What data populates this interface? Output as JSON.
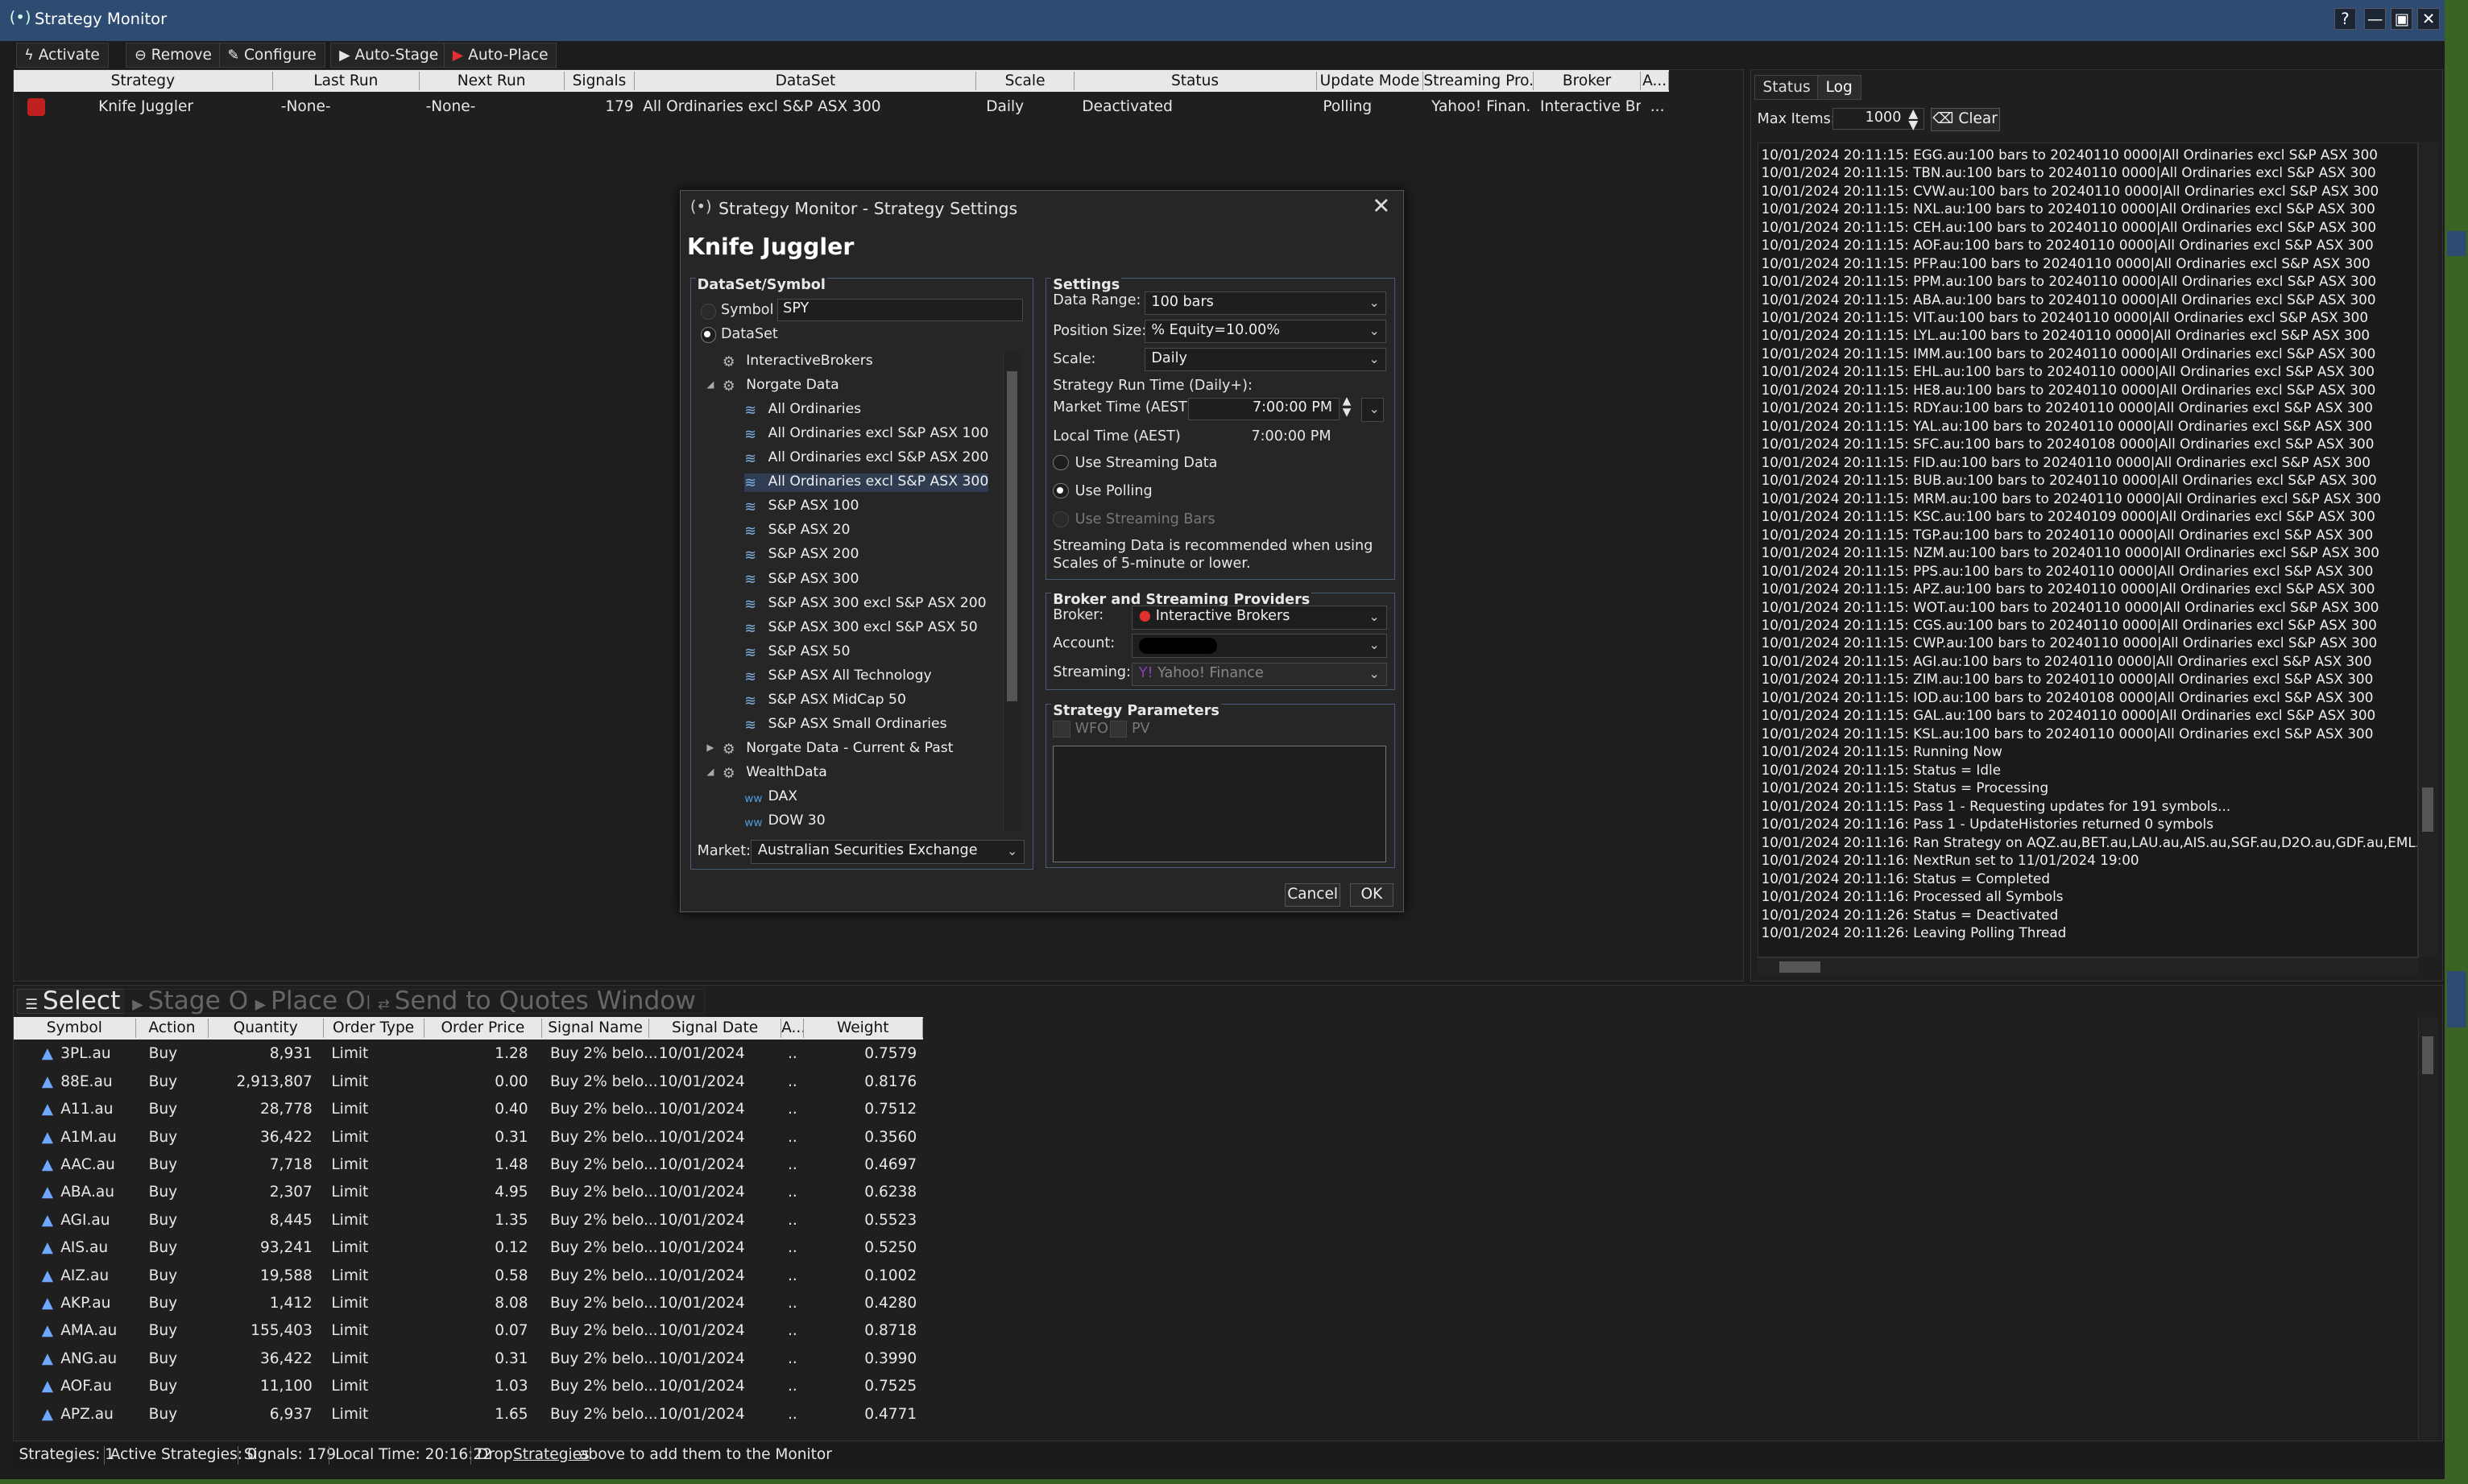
{
  "window": {
    "title": "Strategy Monitor",
    "help": "?",
    "minimize": "—",
    "maximize": "▣",
    "close": "✕"
  },
  "toolbar": {
    "activate": "Activate",
    "remove": "Remove",
    "configure": "Configure",
    "auto_stage": "Auto-Stage",
    "auto_place": "Auto-Place"
  },
  "strategies": {
    "columns": [
      "Strategy",
      "Last Run",
      "Next Run",
      "Signals",
      "DataSet",
      "Scale",
      "Status",
      "Update Mode",
      "Streaming Pro...",
      "Broker",
      "A..."
    ],
    "row": {
      "strategy": "Knife Juggler",
      "last_run": "-None-",
      "next_run": "-None-",
      "signals": "179",
      "dataset": "All Ordinaries excl S&P ASX 300",
      "scale": "Daily",
      "status": "Deactivated",
      "update_mode": "Polling",
      "streaming": "Yahoo! Finan...",
      "broker": "Interactive Br...",
      "a": "..."
    }
  },
  "right": {
    "tab_status": "Status",
    "tab_log": "Log",
    "max_items_label": "Max Items:",
    "max_items": "1000",
    "clear": "Clear",
    "log": [
      "10/01/2024 20:11:15: EGG.au:100 bars to 20240110 0000|All Ordinaries excl S&P ASX 300",
      "10/01/2024 20:11:15: TBN.au:100 bars to 20240110 0000|All Ordinaries excl S&P ASX 300",
      "10/01/2024 20:11:15: CVW.au:100 bars to 20240110 0000|All Ordinaries excl S&P ASX 300",
      "10/01/2024 20:11:15: NXL.au:100 bars to 20240110 0000|All Ordinaries excl S&P ASX 300",
      "10/01/2024 20:11:15: CEH.au:100 bars to 20240110 0000|All Ordinaries excl S&P ASX 300",
      "10/01/2024 20:11:15: AOF.au:100 bars to 20240110 0000|All Ordinaries excl S&P ASX 300",
      "10/01/2024 20:11:15: PFP.au:100 bars to 20240110 0000|All Ordinaries excl S&P ASX 300",
      "10/01/2024 20:11:15: PPM.au:100 bars to 20240110 0000|All Ordinaries excl S&P ASX 300",
      "10/01/2024 20:11:15: ABA.au:100 bars to 20240110 0000|All Ordinaries excl S&P ASX 300",
      "10/01/2024 20:11:15: VIT.au:100 bars to 20240110 0000|All Ordinaries excl S&P ASX 300",
      "10/01/2024 20:11:15: LYL.au:100 bars to 20240110 0000|All Ordinaries excl S&P ASX 300",
      "10/01/2024 20:11:15: IMM.au:100 bars to 20240110 0000|All Ordinaries excl S&P ASX 300",
      "10/01/2024 20:11:15: EHL.au:100 bars to 20240110 0000|All Ordinaries excl S&P ASX 300",
      "10/01/2024 20:11:15: HE8.au:100 bars to 20240110 0000|All Ordinaries excl S&P ASX 300",
      "10/01/2024 20:11:15: RDY.au:100 bars to 20240110 0000|All Ordinaries excl S&P ASX 300",
      "10/01/2024 20:11:15: YAL.au:100 bars to 20240110 0000|All Ordinaries excl S&P ASX 300",
      "10/01/2024 20:11:15: SFC.au:100 bars to 20240108 0000|All Ordinaries excl S&P ASX 300",
      "10/01/2024 20:11:15: FID.au:100 bars to 20240110 0000|All Ordinaries excl S&P ASX 300",
      "10/01/2024 20:11:15: BUB.au:100 bars to 20240110 0000|All Ordinaries excl S&P ASX 300",
      "10/01/2024 20:11:15: MRM.au:100 bars to 20240110 0000|All Ordinaries excl S&P ASX 300",
      "10/01/2024 20:11:15: KSC.au:100 bars to 20240109 0000|All Ordinaries excl S&P ASX 300",
      "10/01/2024 20:11:15: TGP.au:100 bars to 20240110 0000|All Ordinaries excl S&P ASX 300",
      "10/01/2024 20:11:15: NZM.au:100 bars to 20240110 0000|All Ordinaries excl S&P ASX 300",
      "10/01/2024 20:11:15: PPS.au:100 bars to 20240110 0000|All Ordinaries excl S&P ASX 300",
      "10/01/2024 20:11:15: APZ.au:100 bars to 20240110 0000|All Ordinaries excl S&P ASX 300",
      "10/01/2024 20:11:15: WOT.au:100 bars to 20240110 0000|All Ordinaries excl S&P ASX 300",
      "10/01/2024 20:11:15: CGS.au:100 bars to 20240110 0000|All Ordinaries excl S&P ASX 300",
      "10/01/2024 20:11:15: CWP.au:100 bars to 20240110 0000|All Ordinaries excl S&P ASX 300",
      "10/01/2024 20:11:15: AGI.au:100 bars to 20240110 0000|All Ordinaries excl S&P ASX 300",
      "10/01/2024 20:11:15: ZIM.au:100 bars to 20240110 0000|All Ordinaries excl S&P ASX 300",
      "10/01/2024 20:11:15: IOD.au:100 bars to 20240108 0000|All Ordinaries excl S&P ASX 300",
      "10/01/2024 20:11:15: GAL.au:100 bars to 20240110 0000|All Ordinaries excl S&P ASX 300",
      "10/01/2024 20:11:15: KSL.au:100 bars to 20240110 0000|All Ordinaries excl S&P ASX 300",
      "10/01/2024 20:11:15: Running Now",
      "10/01/2024 20:11:15: Status = Idle",
      "10/01/2024 20:11:15: Status = Processing",
      "10/01/2024 20:11:15: Pass 1 - Requesting updates for 191 symbols...",
      "10/01/2024 20:11:16: Pass 1 - UpdateHistories returned 0 symbols",
      "10/01/2024 20:11:16: Ran Strategy on AQZ.au,BET.au,LAU.au,AIS.au,SGF.au,D2O.au,GDF.au,EML.au,MAD.",
      "10/01/2024 20:11:16: NextRun set to 11/01/2024 19:00",
      "10/01/2024 20:11:16: Status = Completed",
      "10/01/2024 20:11:16: Processed all Symbols",
      "10/01/2024 20:11:26: Status = Deactivated",
      "10/01/2024 20:11:26: Leaving Polling Thread"
    ]
  },
  "orders": {
    "select_all": "Select All",
    "stage_orders": "Stage Orders",
    "place_orders": "Place Orders",
    "send_quotes": "Send to Quotes Window",
    "columns": [
      "Symbol",
      "Action",
      "Quantity",
      "Order Type",
      "Order Price",
      "Signal Name",
      "Signal Date",
      "A...",
      "Weight"
    ],
    "rows": [
      [
        "3PL.au",
        "Buy",
        "8,931",
        "Limit",
        "1.28",
        "Buy 2% belo...",
        "10/01/2024",
        "..",
        "0.7579"
      ],
      [
        "88E.au",
        "Buy",
        "2,913,807",
        "Limit",
        "0.00",
        "Buy 2% belo...",
        "10/01/2024",
        "..",
        "0.8176"
      ],
      [
        "A11.au",
        "Buy",
        "28,778",
        "Limit",
        "0.40",
        "Buy 2% belo...",
        "10/01/2024",
        "..",
        "0.7512"
      ],
      [
        "A1M.au",
        "Buy",
        "36,422",
        "Limit",
        "0.31",
        "Buy 2% belo...",
        "10/01/2024",
        "..",
        "0.3560"
      ],
      [
        "AAC.au",
        "Buy",
        "7,718",
        "Limit",
        "1.48",
        "Buy 2% belo...",
        "10/01/2024",
        "..",
        "0.4697"
      ],
      [
        "ABA.au",
        "Buy",
        "2,307",
        "Limit",
        "4.95",
        "Buy 2% belo...",
        "10/01/2024",
        "..",
        "0.6238"
      ],
      [
        "AGI.au",
        "Buy",
        "8,445",
        "Limit",
        "1.35",
        "Buy 2% belo...",
        "10/01/2024",
        "..",
        "0.5523"
      ],
      [
        "AIS.au",
        "Buy",
        "93,241",
        "Limit",
        "0.12",
        "Buy 2% belo...",
        "10/01/2024",
        "..",
        "0.5250"
      ],
      [
        "AIZ.au",
        "Buy",
        "19,588",
        "Limit",
        "0.58",
        "Buy 2% belo...",
        "10/01/2024",
        "..",
        "0.1002"
      ],
      [
        "AKP.au",
        "Buy",
        "1,412",
        "Limit",
        "8.08",
        "Buy 2% belo...",
        "10/01/2024",
        "..",
        "0.4280"
      ],
      [
        "AMA.au",
        "Buy",
        "155,403",
        "Limit",
        "0.07",
        "Buy 2% belo...",
        "10/01/2024",
        "..",
        "0.8718"
      ],
      [
        "ANG.au",
        "Buy",
        "36,422",
        "Limit",
        "0.31",
        "Buy 2% belo...",
        "10/01/2024",
        "..",
        "0.3990"
      ],
      [
        "AOF.au",
        "Buy",
        "11,100",
        "Limit",
        "1.03",
        "Buy 2% belo...",
        "10/01/2024",
        "..",
        "0.7525"
      ],
      [
        "APZ.au",
        "Buy",
        "6,937",
        "Limit",
        "1.65",
        "Buy 2% belo...",
        "10/01/2024",
        "..",
        "0.4771"
      ]
    ]
  },
  "statusbar": {
    "strategies": "Strategies: 1",
    "active": "Active Strategies: 0",
    "signals": "Signals: 179",
    "local_time": "Local Time: 20:16:22",
    "drop_pre": "Drop",
    "drop_link": "Strategies",
    "drop_post": "above to add them to the Monitor"
  },
  "dialog": {
    "title": "Strategy Monitor - Strategy Settings",
    "heading": "Knife Juggler",
    "dataset_group": "DataSet/Symbol",
    "symbol_label": "Symbol",
    "symbol_value": "SPY",
    "dataset_label": "DataSet",
    "tree": [
      {
        "label": "InteractiveBrokers",
        "kind": "gear",
        "depth": 1,
        "exp": ""
      },
      {
        "label": "Norgate Data",
        "kind": "gear",
        "depth": 1,
        "exp": "◢"
      },
      {
        "label": "All Ordinaries",
        "kind": "ds",
        "depth": 2,
        "exp": ""
      },
      {
        "label": "All Ordinaries excl S&P ASX 100",
        "kind": "ds",
        "depth": 2,
        "exp": ""
      },
      {
        "label": "All Ordinaries excl S&P ASX 200",
        "kind": "ds",
        "depth": 2,
        "exp": ""
      },
      {
        "label": "All Ordinaries excl S&P ASX 300",
        "kind": "ds",
        "depth": 2,
        "exp": "",
        "selected": true
      },
      {
        "label": "S&P ASX 100",
        "kind": "ds",
        "depth": 2,
        "exp": ""
      },
      {
        "label": "S&P ASX 20",
        "kind": "ds",
        "depth": 2,
        "exp": ""
      },
      {
        "label": "S&P ASX 200",
        "kind": "ds",
        "depth": 2,
        "exp": ""
      },
      {
        "label": "S&P ASX 300",
        "kind": "ds",
        "depth": 2,
        "exp": ""
      },
      {
        "label": "S&P ASX 300 excl S&P ASX 200",
        "kind": "ds",
        "depth": 2,
        "exp": ""
      },
      {
        "label": "S&P ASX 300 excl S&P ASX 50",
        "kind": "ds",
        "depth": 2,
        "exp": ""
      },
      {
        "label": "S&P ASX 50",
        "kind": "ds",
        "depth": 2,
        "exp": ""
      },
      {
        "label": "S&P ASX All Technology",
        "kind": "ds",
        "depth": 2,
        "exp": ""
      },
      {
        "label": "S&P ASX MidCap 50",
        "kind": "ds",
        "depth": 2,
        "exp": ""
      },
      {
        "label": "S&P ASX Small Ordinaries",
        "kind": "ds",
        "depth": 2,
        "exp": ""
      },
      {
        "label": "Norgate Data - Current & Past",
        "kind": "gear",
        "depth": 1,
        "exp": "▶"
      },
      {
        "label": "WealthData",
        "kind": "gear",
        "depth": 1,
        "exp": "◢"
      },
      {
        "label": "DAX",
        "kind": "wd",
        "depth": 2,
        "exp": ""
      },
      {
        "label": "DOW 30",
        "kind": "wd",
        "depth": 2,
        "exp": ""
      }
    ],
    "market_label": "Market:",
    "market_value": "Australian Securities Exchange",
    "settings_group": "Settings",
    "data_range_label": "Data Range:",
    "data_range": "100 bars",
    "position_size_label": "Position Size:",
    "position_size": "% Equity=10.00%",
    "scale_label": "Scale:",
    "scale": "Daily",
    "run_time_label": "Strategy Run Time (Daily+):",
    "market_time_label": "Market Time (AEST)",
    "market_time": "7:00:00 PM",
    "local_time_label": "Local Time (AEST)",
    "local_time": "7:00:00 PM",
    "use_streaming": "Use Streaming Data",
    "use_polling": "Use Polling",
    "use_streaming_bars": "Use Streaming Bars",
    "streaming_note": "Streaming Data is recommended when using Scales of 5-minute or lower.",
    "broker_group": "Broker and Streaming Providers",
    "broker_label": "Broker:",
    "broker": "Interactive Brokers",
    "account_label": "Account:",
    "streaming_label": "Streaming:",
    "streaming": "Yahoo! Finance",
    "params_group": "Strategy Parameters",
    "wfo": "WFO",
    "pv": "PV",
    "cancel": "Cancel",
    "ok": "OK"
  },
  "colors": {
    "titlebar": "#2e4c72",
    "background": "#1c1c1c",
    "accent": "#4a5a78",
    "buy_arrow": "#6fa8ff",
    "strategy_icon": "#e03030"
  }
}
